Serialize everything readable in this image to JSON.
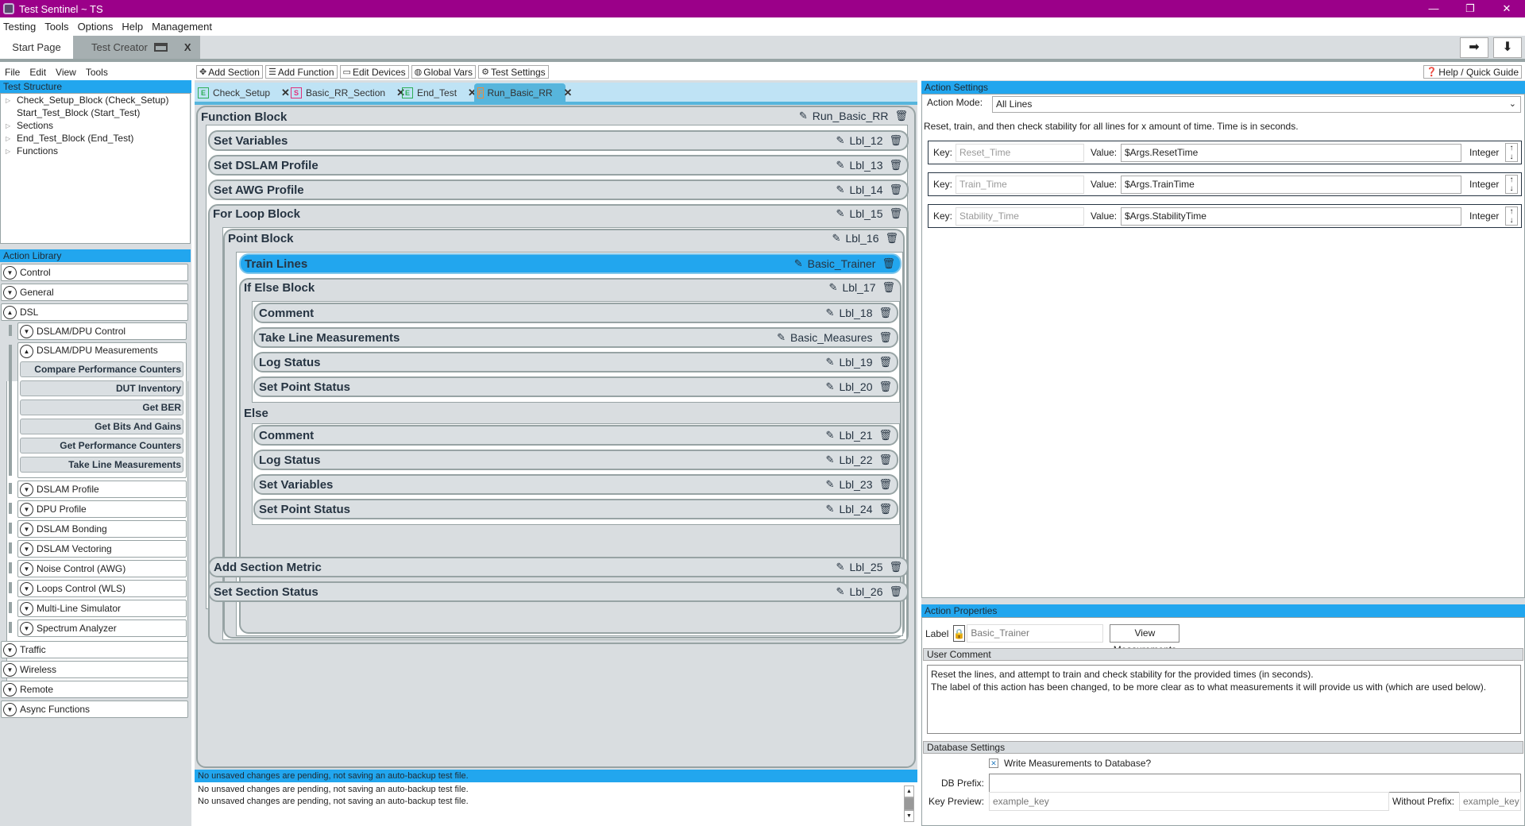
{
  "window": {
    "title": "Test Sentinel ~ TS",
    "controls": [
      "—",
      "❐",
      "✕"
    ]
  },
  "menu": [
    "Testing",
    "Tools",
    "Options",
    "Help",
    "Management"
  ],
  "doc_tabs": [
    {
      "label": "Start Page"
    },
    {
      "label": "Test Creator",
      "close": "X"
    }
  ],
  "nav_buttons": {
    "next": "➡",
    "down": "⬇"
  },
  "submenu": [
    "File",
    "Edit",
    "View",
    "Tools"
  ],
  "toolbar": [
    {
      "label": "Add Section",
      "icon": "✥"
    },
    {
      "label": "Add Function",
      "icon": "☰"
    },
    {
      "label": "Edit Devices",
      "icon": "▭"
    },
    {
      "label": "Global Vars",
      "icon": "◍"
    },
    {
      "label": "Test Settings",
      "icon": "⚙"
    }
  ],
  "help_button": {
    "label": "Help / Quick Guide",
    "icon": "❓"
  },
  "test_structure": {
    "title": "Test Structure",
    "items": [
      {
        "label": "Check_Setup_Block (Check_Setup)",
        "expandable": true
      },
      {
        "label": "Start_Test_Block (Start_Test)",
        "expandable": false
      },
      {
        "label": "Sections",
        "expandable": true
      },
      {
        "label": "End_Test_Block (End_Test)",
        "expandable": true
      },
      {
        "label": "Functions",
        "expandable": true
      }
    ]
  },
  "action_library": {
    "title": "Action Library",
    "categories": [
      "Control",
      "General",
      "DSL"
    ],
    "dsl_subcategories": [
      "DSLAM/DPU Control",
      "DSLAM/DPU Measurements",
      "DSLAM Profile",
      "DPU Profile",
      "DSLAM Bonding",
      "DSLAM Vectoring",
      "Noise Control (AWG)",
      "Loops Control (WLS)",
      "Multi-Line Simulator",
      "Spectrum Analyzer"
    ],
    "measurement_actions": [
      "Compare Performance Counters",
      "DUT Inventory",
      "Get BER",
      "Get Bits And Gains",
      "Get Performance Counters",
      "Take Line Measurements"
    ],
    "bottom_categories": [
      "Traffic",
      "Wireless",
      "Remote",
      "Async Functions"
    ]
  },
  "file_tabs": [
    {
      "label": "Check_Setup",
      "badge": "E",
      "color": "#2fae57"
    },
    {
      "label": "Basic_RR_Section",
      "badge": "S",
      "color": "#e0307a"
    },
    {
      "label": "End_Test",
      "badge": "E",
      "color": "#2fae57"
    },
    {
      "label": "Run_Basic_RR",
      "badge": "F",
      "color": "#ef8a3a",
      "active": true
    }
  ],
  "blocks": {
    "function_block": {
      "name": "Function Block",
      "label": "Run_Basic_RR"
    },
    "rows": {
      "set_variables": {
        "name": "Set Variables",
        "label": "Lbl_12"
      },
      "set_dslam_profile": {
        "name": "Set DSLAM Profile",
        "label": "Lbl_13"
      },
      "set_awg_profile": {
        "name": "Set AWG Profile",
        "label": "Lbl_14"
      },
      "for_loop": {
        "name": "For Loop Block",
        "label": "Lbl_15"
      },
      "point_block": {
        "name": "Point Block",
        "label": "Lbl_16"
      },
      "train_lines": {
        "name": "Train Lines",
        "label": "Basic_Trainer"
      },
      "if_else": {
        "name": "If Else Block",
        "label": "Lbl_17"
      },
      "comment1": {
        "name": "Comment",
        "label": "Lbl_18"
      },
      "take_line": {
        "name": "Take Line Measurements",
        "label": "Basic_Measures"
      },
      "log_status1": {
        "name": "Log Status",
        "label": "Lbl_19"
      },
      "set_point1": {
        "name": "Set Point Status",
        "label": "Lbl_20"
      },
      "else_label": "Else",
      "comment2": {
        "name": "Comment",
        "label": "Lbl_21"
      },
      "log_status2": {
        "name": "Log Status",
        "label": "Lbl_22"
      },
      "set_variables2": {
        "name": "Set Variables",
        "label": "Lbl_23"
      },
      "set_point2": {
        "name": "Set Point Status",
        "label": "Lbl_24"
      },
      "add_metric": {
        "name": "Add Section Metric",
        "label": "Lbl_25"
      },
      "set_section": {
        "name": "Set Section Status",
        "label": "Lbl_26"
      }
    }
  },
  "status": {
    "current": "No unsaved changes are pending, not saving an auto-backup test file.",
    "log": [
      "No unsaved changes are pending, not saving an auto-backup test file.",
      "No unsaved changes are pending, not saving an auto-backup test file."
    ]
  },
  "action_settings": {
    "title": "Action Settings",
    "mode_label": "Action Mode:",
    "mode_value": "All Lines",
    "description": "Reset, train, and then check stability for all lines for x amount of time. Time is in seconds.",
    "key_label": "Key:",
    "value_label": "Value:",
    "params": [
      {
        "key": "Reset_Time",
        "value": "$Args.ResetTime",
        "type": "Integer"
      },
      {
        "key": "Train_Time",
        "value": "$Args.TrainTime",
        "type": "Integer"
      },
      {
        "key": "Stability_Time",
        "value": "$Args.StabilityTime",
        "type": "Integer"
      }
    ]
  },
  "action_properties": {
    "title": "Action Properties",
    "label_caption": "Label",
    "label_value": "Basic_Trainer",
    "view_button": "View Measurements",
    "comment_title": "User Comment",
    "comment_lines": [
      "Reset the lines, and attempt to train and check stability for the provided times (in seconds).",
      "The label of this action has been changed, to be more clear as to what measurements it will provide us with (which are used below)."
    ],
    "db_title": "Database Settings",
    "db_write_label": "Write Measurements to Database?",
    "db_write_checked": true,
    "db_prefix_label": "DB Prefix:",
    "db_prefix_value": "",
    "key_preview_label": "Key Preview:",
    "key_preview_value": "example_key",
    "without_prefix_label": "Without Prefix:",
    "without_prefix_value": "example_key"
  }
}
